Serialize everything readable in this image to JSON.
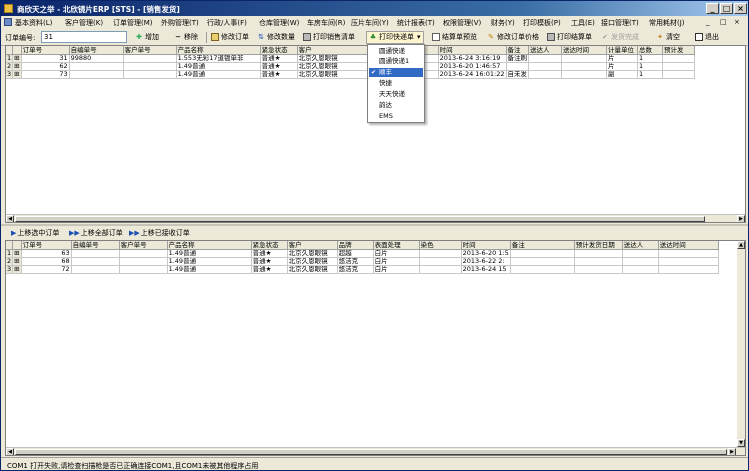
{
  "window": {
    "title": "商欣天之举 - 北欣镜片ERP [STS] - [销售发货]",
    "controls": [
      "_",
      "□",
      "×"
    ]
  },
  "menu": [
    "基本资料(L)",
    "客户管理(K)",
    "订单管理(M)",
    "外购管理(T)",
    "行政/人事(F)",
    "仓库管理(W)",
    "车房车间(R)",
    "压片车间(Y)",
    "统计报表(T)",
    "权限管理(V)",
    "财务(Y)",
    "打印模板(P)",
    "工具(E)",
    "接口管理(T)",
    "常用耗材(J)"
  ],
  "menu_controls": [
    "_",
    "□",
    "×"
  ],
  "toolbar": {
    "order_no_label": "订单编号:",
    "order_no_value": "31",
    "buttons": {
      "add": "增加",
      "remove": "移除",
      "modify_order": "修改订单",
      "modify_qty": "修改数量",
      "print_list": "打印销售清单",
      "print_express": "打印快递单",
      "settle_preview": "结算单预览",
      "modify_price": "修改订单价格",
      "print_settle": "打印结算单",
      "ship_complete": "发货完成",
      "clear": "清空",
      "exit": "退出"
    }
  },
  "dropdown": {
    "items": [
      "圆通快递",
      "圆通快递1",
      "顺丰",
      "快捷",
      "天天快递",
      "韵达",
      "EMS"
    ],
    "selected": "顺丰"
  },
  "top_grid": {
    "columns": [
      "订单号",
      "自编单号",
      "客户单号",
      "产品名称",
      "紧急状态",
      "客户",
      "",
      "",
      "染色",
      "时间",
      "备注",
      "送达人",
      "送达时间",
      "计量单位",
      "总数",
      "预计发"
    ],
    "rows": [
      {
        "rn": "1",
        "order": "31",
        "self": "99880",
        "cust_no": "",
        "product": "1.553无彩17道镀单非",
        "urgent": "普通★",
        "customer": "北京久恩眼镜",
        "time": "2013-6-24 3:16:19",
        "note": "备注刷",
        "unit": "片",
        "total": "1"
      },
      {
        "rn": "2",
        "order": "62",
        "self": "",
        "cust_no": "",
        "product": "1.49普通",
        "urgent": "普通★",
        "customer": "北京久恩眼镜",
        "time": "2013-6-20 1:46:57",
        "note": "",
        "unit": "片",
        "total": "1"
      },
      {
        "rn": "3",
        "order": "73",
        "self": "",
        "cust_no": "",
        "product": "1.49普通",
        "urgent": "普通★",
        "customer": "北京久恩眼镜",
        "time": "2013-6-24 16:01:22",
        "note": "自未发",
        "unit": "副",
        "total": "1"
      }
    ]
  },
  "actions": {
    "move_selected": "上移选中订单",
    "move_all": "上移全部订单",
    "move_received": "上移已接收订单"
  },
  "bottom_grid": {
    "columns": [
      "订单号",
      "自编单号",
      "客户单号",
      "产品名称",
      "紧急状态",
      "客户",
      "品牌",
      "表面处理",
      "染色",
      "时间",
      "备注",
      "预计发货日期",
      "送达人",
      "送达时间"
    ],
    "rows": [
      {
        "rn": "1",
        "order": "63",
        "product": "1.49普通",
        "urgent": "普通★",
        "customer": "北京久恩眼镜",
        "brand": "超越",
        "surface": "白片",
        "time": "2013-6-20 1:5"
      },
      {
        "rn": "2",
        "order": "68",
        "product": "1.49普通",
        "urgent": "普通★",
        "customer": "北京久恩眼镜",
        "brand": "悠洁克",
        "surface": "白片",
        "time": "2013-6-22 2:"
      },
      {
        "rn": "3",
        "order": "72",
        "product": "1.49普通",
        "urgent": "普通★",
        "customer": "北京久恩眼镜",
        "brand": "悠洁克",
        "surface": "白片",
        "time": "2013-6-24 15"
      }
    ]
  },
  "status_text": "COM1 打开失败,请检查扫描枪是否已正确连接COM1,且COM1未被其他程序占用",
  "colors": {
    "accent": "#316ac5",
    "title": "#0a246a",
    "arrow": "#1a4fb0"
  }
}
